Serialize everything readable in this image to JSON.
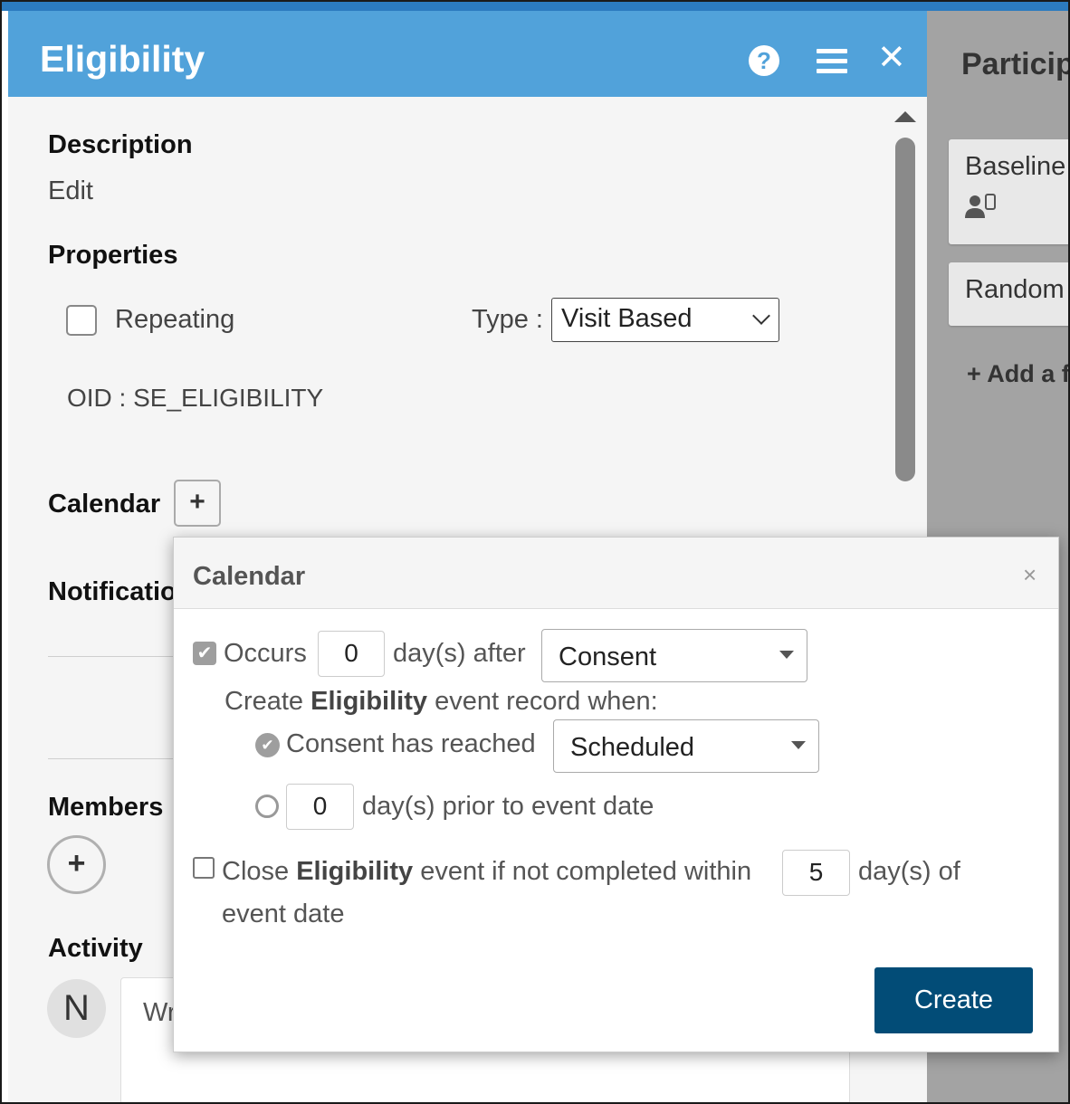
{
  "board": {
    "title": "Particip",
    "cards": [
      "Baseline",
      "Random"
    ],
    "add_label": "+ Add a f"
  },
  "panel": {
    "title": "Eligibility",
    "description": {
      "heading": "Description",
      "edit_label": "Edit"
    },
    "properties": {
      "heading": "Properties",
      "repeating_label": "Repeating",
      "repeating_checked": false,
      "type_label": "Type :",
      "type_value": "Visit Based",
      "oid": "OID : SE_ELIGIBILITY"
    },
    "calendar": {
      "heading": "Calendar",
      "add_label": "+"
    },
    "notifications": {
      "heading": "Notificatio"
    },
    "members": {
      "heading": "Members",
      "add_label": "+"
    },
    "activity": {
      "heading": "Activity",
      "avatar_initial": "N",
      "comment_placeholder": "Wr"
    }
  },
  "modal": {
    "title": "Calendar",
    "close_label": "×",
    "occurs": {
      "checked": true,
      "label": "Occurs",
      "days_value": "0",
      "after_label": "day(s) after",
      "event_select": "Consent"
    },
    "create_when": {
      "prefix": "Create",
      "event_name": "Eligibility",
      "suffix": "event record when:"
    },
    "option_reached": {
      "selected": true,
      "label": "Consent has reached",
      "status_select": "Scheduled"
    },
    "option_prior": {
      "selected": false,
      "days_value": "0",
      "label": "day(s) prior to event date"
    },
    "close_rule": {
      "checked": false,
      "prefix": "Close",
      "event_name": "Eligibility",
      "middle": "event if not completed within",
      "days_value": "5",
      "suffix": "day(s) of",
      "line2": "event date"
    },
    "create_button": "Create"
  }
}
